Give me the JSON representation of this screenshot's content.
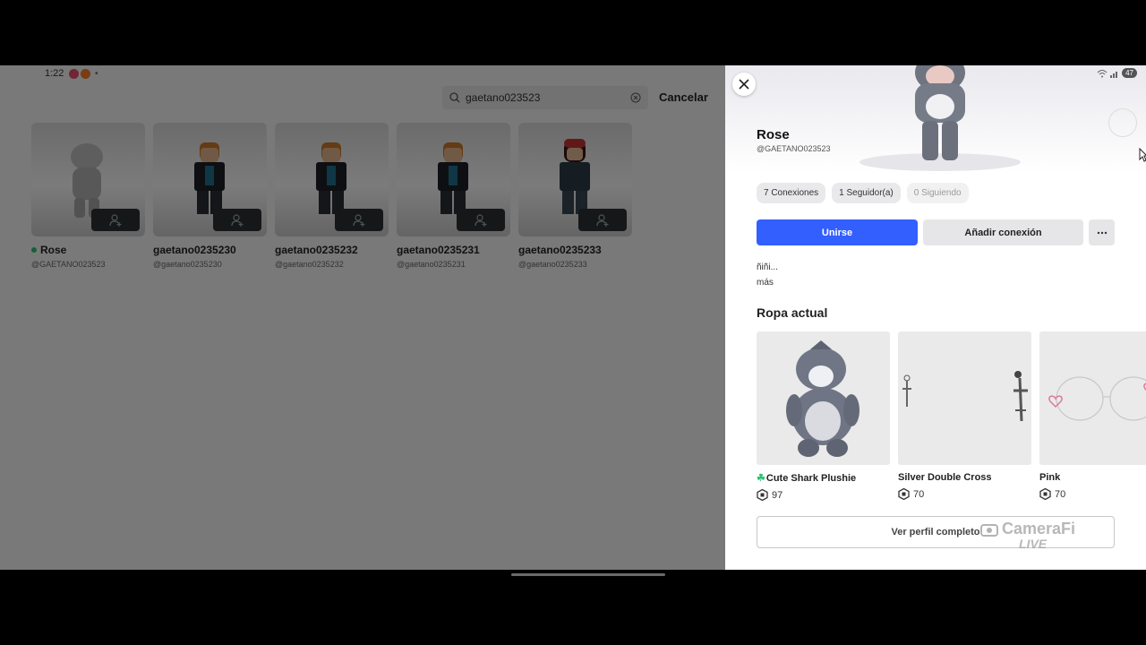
{
  "status_bar": {
    "time": "1:22",
    "extra": "•",
    "battery": "47"
  },
  "search": {
    "query": "gaetano023523",
    "cancel_label": "Cancelar"
  },
  "results": [
    {
      "name": "Rose",
      "handle": "@GAETANO023523",
      "online": true
    },
    {
      "name": "gaetano0235230",
      "handle": "@gaetano0235230",
      "online": false
    },
    {
      "name": "gaetano0235232",
      "handle": "@gaetano0235232",
      "online": false
    },
    {
      "name": "gaetano0235231",
      "handle": "@gaetano0235231",
      "online": false
    },
    {
      "name": "gaetano0235233",
      "handle": "@gaetano0235233",
      "online": false
    }
  ],
  "profile": {
    "name": "Rose",
    "handle": "@GAETANO023523",
    "stats": {
      "connections": "7 Conexiones",
      "followers": "1 Seguidor(a)",
      "following": "0 Siguiendo"
    },
    "join_label": "Unirse",
    "add_connection_label": "Añadir conexión",
    "bio": "ñiñi...",
    "more_label": "más",
    "current_outfit_title": "Ropa actual",
    "items": [
      {
        "name": "Cute Shark Plushie",
        "price": "97",
        "badge": "☘"
      },
      {
        "name": "Silver Double Cross",
        "price": "70"
      },
      {
        "name": "Pink",
        "price": "70"
      }
    ],
    "full_profile_label": "Ver perfil completo"
  },
  "watermark": {
    "brand": "CameraFi",
    "sub": "LIVE"
  },
  "colors": {
    "primary_button": "#335fff",
    "online": "#2fbf71",
    "backdrop": "rgba(0,0,0,0.5)"
  }
}
